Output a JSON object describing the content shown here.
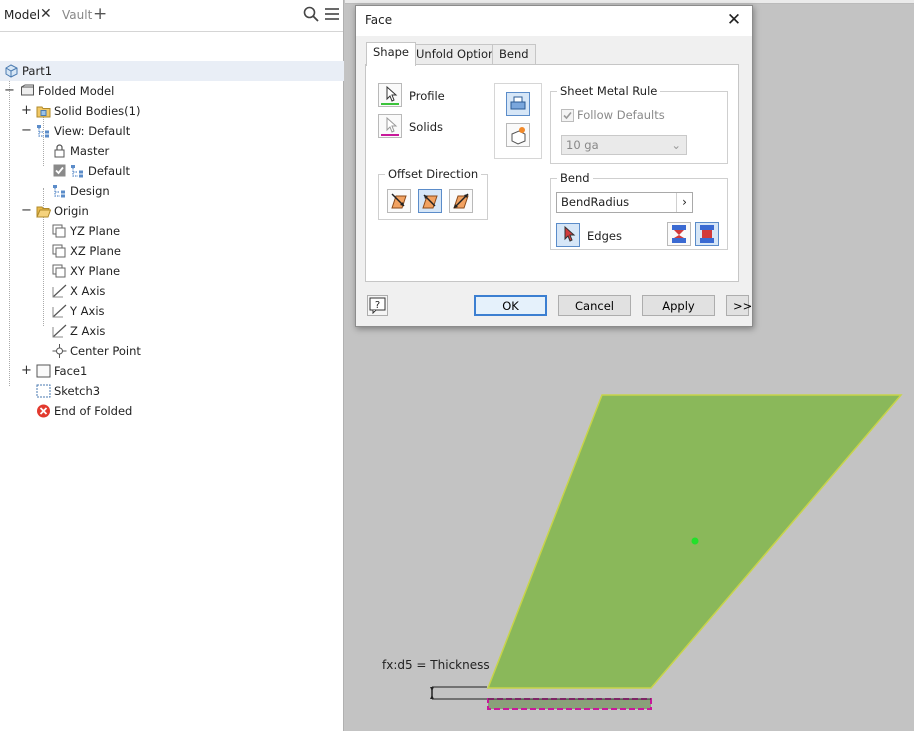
{
  "browser": {
    "tabs": [
      {
        "label": "Model"
      },
      {
        "label": "Vault"
      }
    ],
    "tree": [
      {
        "label": "Part1"
      },
      {
        "label": "Folded Model"
      },
      {
        "label": "Solid Bodies(1)"
      },
      {
        "label": "View: Default"
      },
      {
        "label": "Master"
      },
      {
        "label": "Default"
      },
      {
        "label": "Design"
      },
      {
        "label": "Origin"
      },
      {
        "label": "YZ Plane"
      },
      {
        "label": "XZ Plane"
      },
      {
        "label": "XY Plane"
      },
      {
        "label": "X Axis"
      },
      {
        "label": "Y Axis"
      },
      {
        "label": "Z Axis"
      },
      {
        "label": "Center Point"
      },
      {
        "label": "Face1"
      },
      {
        "label": "Sketch3"
      },
      {
        "label": "End of Folded"
      }
    ]
  },
  "dialog": {
    "title": "Face",
    "tabs": [
      {
        "label": "Shape"
      },
      {
        "label": "Unfold Options"
      },
      {
        "label": "Bend"
      }
    ],
    "profile_label": "Profile",
    "solids_label": "Solids",
    "sheet_metal_rule": {
      "title": "Sheet Metal Rule",
      "follow_defaults_label": "Follow Defaults",
      "follow_defaults_checked": true,
      "rule_value": "10 ga"
    },
    "offset_direction_title": "Offset Direction",
    "bend": {
      "title": "Bend",
      "radius_value": "BendRadius",
      "edges_label": "Edges"
    },
    "buttons": {
      "ok": "OK",
      "cancel": "Cancel",
      "apply": "Apply",
      "more": ">>"
    }
  },
  "viewport": {
    "dimension_text": "fx:d5 = Thickness",
    "face_color": "#8ab85a",
    "face_edge_color": "#c8d44a",
    "selection_color": "#c8189a"
  }
}
